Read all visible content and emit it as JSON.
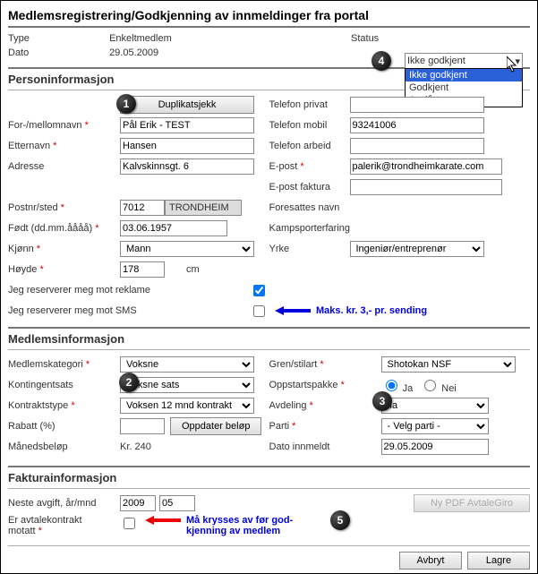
{
  "page_title": "Medlemsregistrering/Godkjenning av innmeldinger fra portal",
  "meta": {
    "type_label": "Type",
    "type_value": "Enkeltmedlem",
    "date_label": "Dato",
    "date_value": "29.05.2009",
    "status_label": "Status"
  },
  "status": {
    "selected": "Ikke godkjent",
    "options": [
      "Ikke godkjent",
      "Godkjent",
      "Avslått"
    ]
  },
  "sections": {
    "person": "Personinformasjon",
    "member": "Medlemsinformasjon",
    "invoice": "Fakturainformasjon"
  },
  "person": {
    "dup_btn": "Duplikatsjekk",
    "fn_label": "For-/mellomnavn",
    "fn_value": "Pål Erik - TEST",
    "ln_label": "Etternavn",
    "ln_value": "Hansen",
    "addr_label": "Adresse",
    "addr_value": "Kalvskinnsgt. 6",
    "zip_label": "Postnr/sted",
    "zip_value": "7012",
    "city_value": "TRONDHEIM",
    "dob_label": "Født (dd.mm.åååå)",
    "dob_value": "03.06.1957",
    "gender_label": "Kjønn",
    "gender_value": "Mann",
    "height_label": "Høyde",
    "height_value": "178",
    "height_unit": "cm",
    "res_ad_label": "Jeg reserverer meg mot reklame",
    "res_sms_label": "Jeg reserverer meg mot SMS",
    "sms_note": "Maks. kr. 3,- pr. sending",
    "phone_priv_label": "Telefon privat",
    "phone_priv_value": "",
    "phone_mob_label": "Telefon mobil",
    "phone_mob_value": "93241006",
    "phone_work_label": "Telefon arbeid",
    "phone_work_value": "",
    "email_label": "E-post",
    "email_value": "palerik@trondheimkarate.com",
    "email_inv_label": "E-post faktura",
    "email_inv_value": "",
    "guardian_label": "Foresattes navn",
    "exp_label": "Kampsporterfaring",
    "job_label": "Yrke",
    "job_value": "Ingeniør/entreprenør"
  },
  "member": {
    "cat_label": "Medlemskategori",
    "cat_value": "Voksne",
    "rate_label": "Kontingentsats",
    "rate_value": "Voksne sats",
    "contract_label": "Kontraktstype",
    "contract_value": "Voksen 12 mnd kontrakt",
    "discount_label": "Rabatt (%)",
    "discount_value": "",
    "update_btn": "Oppdater beløp",
    "monthly_label": "Månedsbeløp",
    "monthly_value": "Kr. 240",
    "style_label": "Gren/stilart",
    "style_value": "Shotokan NSF",
    "startpack_label": "Oppstartspakke",
    "yes": "Ja",
    "no": "Nei",
    "dept_label": "Avdeling",
    "dept_value": "Ila",
    "party_label": "Parti",
    "party_value": "- Velg parti -",
    "enrolled_label": "Dato innmeldt",
    "enrolled_value": "29.05.2009"
  },
  "invoice": {
    "next_label": "Neste avgift, år/mnd",
    "year_value": "2009",
    "month_value": "05",
    "pdf_btn": "Ny PDF AvtaleGiro",
    "contract_recv_label_1": "Er avtalekontrakt",
    "contract_recv_label_2": "motatt",
    "note_l1": "Må krysses av før god-",
    "note_l2": "kjenning av medlem"
  },
  "footer": {
    "cancel": "Avbryt",
    "save": "Lagre"
  },
  "badges": {
    "1": "1",
    "2": "2",
    "3": "3",
    "4": "4",
    "5": "5"
  }
}
